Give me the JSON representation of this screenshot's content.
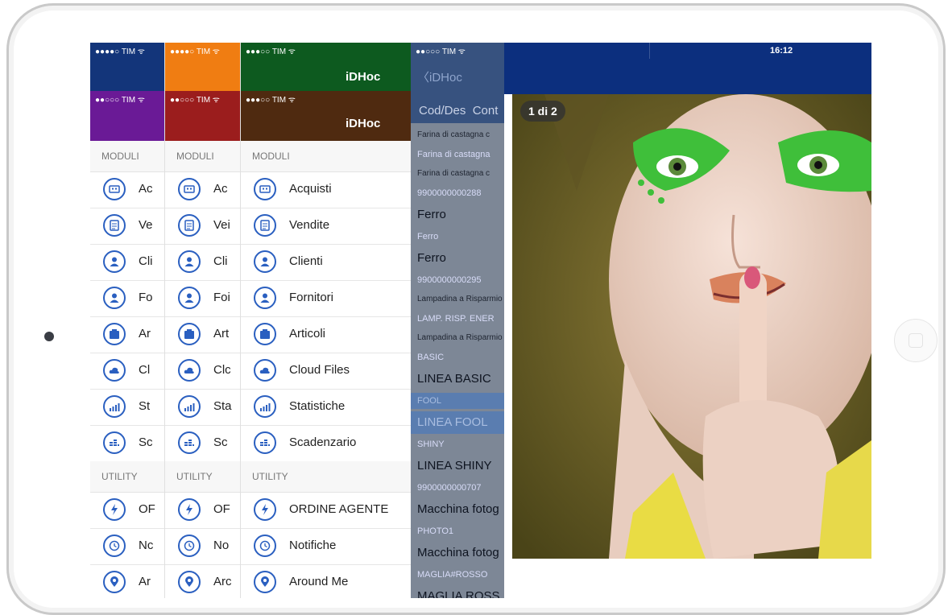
{
  "device": {
    "frame_color": "#c9c9c9"
  },
  "status_bar": {
    "carrier": "TIM",
    "signal_full": "●●●●○",
    "signal_weak": "●●○○○",
    "time": "16:12"
  },
  "app": {
    "name": "iDHoc",
    "back_label": "iDHoc",
    "header_colors": [
      "#13357a",
      "#f07d12",
      "#0d5a1f",
      "#6a1a96",
      "#9b1d1d",
      "#4f2a10"
    ]
  },
  "menu": {
    "modules_header": "MODULI",
    "utility_header": "UTILITY",
    "modules": [
      {
        "label": "Acquisti",
        "icon": "purchases-icon"
      },
      {
        "label": "Vendite",
        "icon": "sales-icon"
      },
      {
        "label": "Clienti",
        "icon": "customers-icon"
      },
      {
        "label": "Fornitori",
        "icon": "suppliers-icon"
      },
      {
        "label": "Articoli",
        "icon": "items-icon"
      },
      {
        "label": "Cloud Files",
        "icon": "cloud-icon"
      },
      {
        "label": "Statistiche",
        "icon": "statistics-icon"
      },
      {
        "label": "Scadenzario",
        "icon": "schedule-icon"
      }
    ],
    "utility": [
      {
        "label": "ORDINE AGENTE",
        "icon": "lightning-icon"
      },
      {
        "label": "Notifiche",
        "icon": "clock-icon"
      },
      {
        "label": "Around Me",
        "icon": "location-pin-icon"
      }
    ],
    "truncated_labels": {
      "p1": [
        "Ac",
        "Ve",
        "Cli",
        "Fo",
        "Ar",
        "Cl",
        "St",
        "Sc",
        "OF",
        "Nc",
        "Ar"
      ],
      "p2": [
        "Ac",
        "Vei",
        "Cli",
        "Foi",
        "Art",
        "Clc",
        "Sta",
        "Sc",
        "OF",
        "No",
        "Arc"
      ]
    }
  },
  "list": {
    "tabs": "Cod/Des  Cont",
    "items": [
      {
        "text": "Farina di castagna c",
        "kind": "small"
      },
      {
        "text": "Farina di castagna",
        "kind": "code"
      },
      {
        "text": "Farina di castagna c",
        "kind": "small"
      },
      {
        "text": "9900000000288",
        "kind": "code"
      },
      {
        "text": "Ferro",
        "kind": "big"
      },
      {
        "text": "Ferro",
        "kind": "code"
      },
      {
        "text": "Ferro",
        "kind": "big"
      },
      {
        "text": "9900000000295",
        "kind": "code"
      },
      {
        "text": "Lampadina a Risparmio",
        "kind": "small"
      },
      {
        "text": "LAMP. RISP. ENER",
        "kind": "code"
      },
      {
        "text": "Lampadina a Risparmio",
        "kind": "small"
      },
      {
        "text": "BASIC",
        "kind": "code"
      },
      {
        "text": "LINEA BASIC",
        "kind": "big"
      },
      {
        "text": "FOOL",
        "kind": "code"
      },
      {
        "text": "LINEA FOOL",
        "kind": "big"
      },
      {
        "text": "SHINY",
        "kind": "code"
      },
      {
        "text": "LINEA SHINY",
        "kind": "big"
      },
      {
        "text": "9900000000707",
        "kind": "code"
      },
      {
        "text": "Macchina fotog",
        "kind": "big"
      },
      {
        "text": "PHOTO1",
        "kind": "code"
      },
      {
        "text": "Macchina fotog",
        "kind": "big"
      },
      {
        "text": "MAGLIA#ROSSO",
        "kind": "code"
      },
      {
        "text": "MAGLIA ROSS",
        "kind": "big"
      }
    ]
  },
  "viewer": {
    "page_indicator": "1 di 2"
  }
}
